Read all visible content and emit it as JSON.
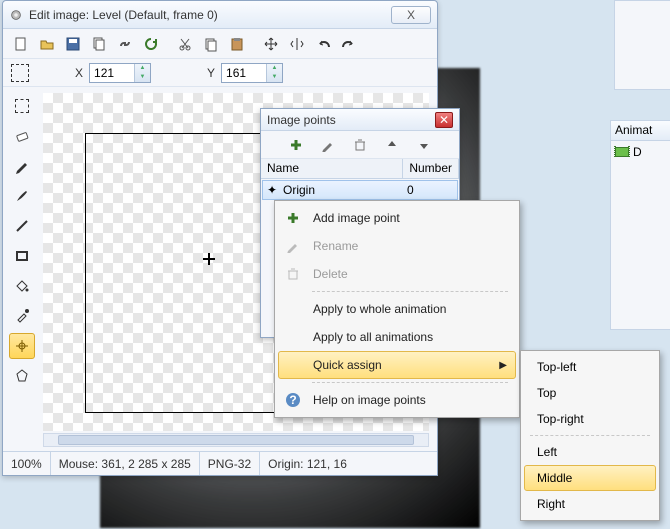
{
  "window": {
    "title": "Edit image: Level (Default, frame 0)",
    "close_glyph": "X"
  },
  "coords": {
    "x_label": "X",
    "x_value": "121",
    "y_label": "Y",
    "y_value": "161"
  },
  "status": {
    "zoom": "100%",
    "mouse": "Mouse: 361, 2 285 x 285",
    "format": "PNG-32",
    "origin": "Origin: 121, 16"
  },
  "image_points": {
    "title": "Image points",
    "col_name": "Name",
    "col_number": "Number",
    "rows": [
      {
        "name": "Origin",
        "number": "0"
      }
    ]
  },
  "ctx": {
    "add": "Add image point",
    "rename": "Rename",
    "delete": "Delete",
    "apply_whole": "Apply to whole animation",
    "apply_all": "Apply to all animations",
    "quick": "Quick assign",
    "help": "Help on image points"
  },
  "quick_assign": {
    "tl": "Top-left",
    "t": "Top",
    "tr": "Top-right",
    "l": "Left",
    "m": "Middle",
    "r": "Right"
  },
  "anim_panel": {
    "title": "Animat",
    "item": "D"
  }
}
